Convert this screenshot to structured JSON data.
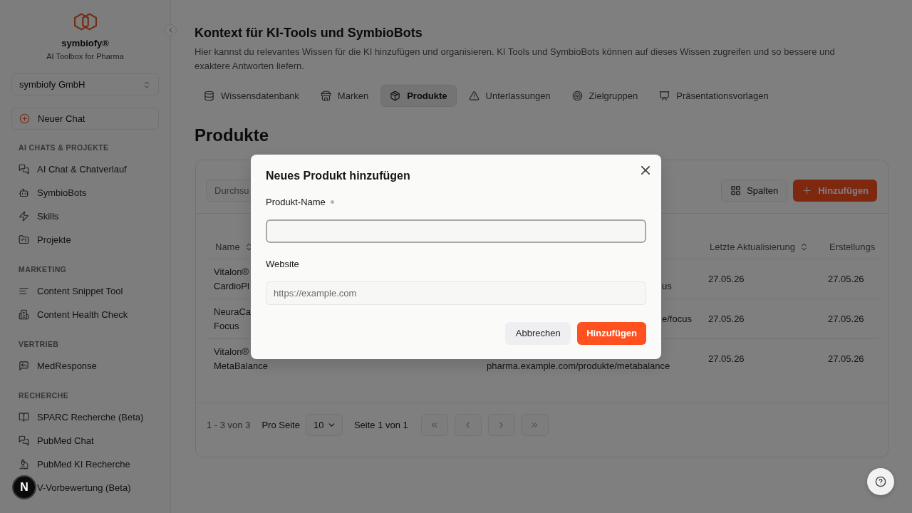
{
  "sidebar": {
    "brand": {
      "name": "symbiofy®",
      "tagline": "AI Toolbox for Pharma"
    },
    "org_select": {
      "value": "symbiofy GmbH"
    },
    "new_chat_button": {
      "label": "Neuer Chat"
    },
    "sections": [
      {
        "title": "AI CHATS & PROJEKTE",
        "items": [
          {
            "label": "AI Chat & Chatverlauf"
          },
          {
            "label": "SymbioBots"
          },
          {
            "label": "Skills"
          },
          {
            "label": "Projekte"
          }
        ]
      },
      {
        "title": "MARKETING",
        "items": [
          {
            "label": "Content Snippet Tool"
          },
          {
            "label": "Content Health Check"
          }
        ]
      },
      {
        "title": "VERTRIEB",
        "items": [
          {
            "label": "MedResponse"
          }
        ]
      },
      {
        "title": "RECHERCHE",
        "items": [
          {
            "label": "SPARC Recherche (Beta)"
          },
          {
            "label": "PubMed Chat"
          },
          {
            "label": "PubMed KI Recherche"
          },
          {
            "label": "V-Vorbewertung (Beta)"
          }
        ]
      }
    ]
  },
  "main": {
    "title": "Kontext für KI-Tools und SymbioBots",
    "description": "Hier kannst du relevantes Wissen für die KI hinzufügen und organisieren. KI Tools und SymbioBots können auf dieses Wissen zugreifen und so bessere und exaktere Antworten liefern.",
    "tabs": [
      {
        "label": "Wissensdatenbank",
        "selected": false
      },
      {
        "label": "Marken",
        "selected": false
      },
      {
        "label": "Produkte",
        "selected": true
      },
      {
        "label": "Unterlassungen",
        "selected": false
      },
      {
        "label": "Zielgruppen",
        "selected": false
      },
      {
        "label": "Präsentationsvorlagen",
        "selected": false
      }
    ],
    "section_title": "Produkte"
  },
  "products_card": {
    "search": {
      "placeholder": "Durchsu"
    },
    "columns_button": {
      "label": "Spalten"
    },
    "add_button": {
      "label": "Hinzufügen"
    },
    "table": {
      "columns": {
        "name": {
          "label": "Name",
          "sortable": true
        },
        "updated": {
          "label": "Letzte Aktualisierung",
          "sortable": true
        },
        "created": {
          "label": "Erstellungs",
          "sortable": false
        }
      },
      "rows": [
        {
          "name": "Vitalon® CardioPl",
          "column_5": {
            "text": "us",
            "start_hidden": true,
            "first_line_hidden": true
          },
          "updated": "27.05.26",
          "created": "27.05.26"
        },
        {
          "name": "NeuraCa Focus",
          "column_5": {
            "text": "e/focus",
            "start_hidden": true,
            "first_line_hidden": false
          },
          "updated": "27.05.26",
          "created": "27.05.26"
        },
        {
          "name": "Vitalon® MetaBalance",
          "column_5": {
            "text": "pharma.example.com/produkte/metabalance",
            "start_hidden": false,
            "first_line_hidden": true
          },
          "updated": "27.05.26",
          "created": "27.05.26"
        }
      ]
    },
    "footer": {
      "range": "1 - 3 von 3",
      "page_size_label": "Pro Seite",
      "page_size": "10",
      "page_label": "Seite 1 von 1",
      "nav_buttons": [
        {
          "disabled": true
        },
        {
          "disabled": true
        },
        {
          "disabled": true
        },
        {
          "disabled": true
        }
      ]
    }
  },
  "dialog": {
    "title": "Neues Produkt hinzufügen",
    "fields": [
      {
        "label": "Produkt-Name",
        "required": true,
        "focused": true
      },
      {
        "label": "Website",
        "required": false,
        "focused": false,
        "placeholder": "https://example.com"
      }
    ],
    "buttons": [
      {
        "label": "Abbrechen",
        "kind": "secondary"
      },
      {
        "label": "Hinzufügen",
        "kind": "primary"
      }
    ]
  },
  "dev_badge": {
    "label": "N"
  }
}
